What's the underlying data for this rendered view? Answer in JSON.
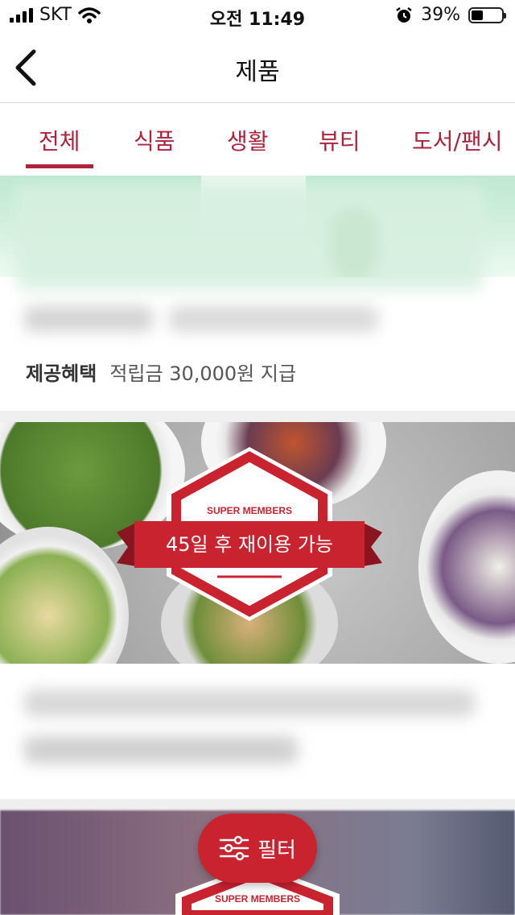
{
  "status_bar": {
    "carrier": "SKT",
    "time": "오전 11:49",
    "battery_percent": "39%",
    "battery_level": 0.39
  },
  "nav": {
    "title": "제품",
    "back_icon": "chevron-left-icon"
  },
  "tabs": [
    {
      "label": "전체",
      "active": true
    },
    {
      "label": "식품",
      "active": false
    },
    {
      "label": "생활",
      "active": false
    },
    {
      "label": "뷰티",
      "active": false
    },
    {
      "label": "도서/팬시",
      "active": false
    }
  ],
  "cards": [
    {
      "benefit_label": "제공혜택",
      "benefit_text": "적립금 30,000원 지급"
    },
    {
      "badge_title": "SUPER MEMBERS",
      "badge_text": "45일 후 재이용 가능"
    },
    {
      "badge_title": "SUPER MEMBERS"
    }
  ],
  "filter_button": {
    "label": "필터",
    "icon": "sliders-icon"
  },
  "colors": {
    "accent": "#b0213a",
    "filter_bg": "#c8232f"
  }
}
